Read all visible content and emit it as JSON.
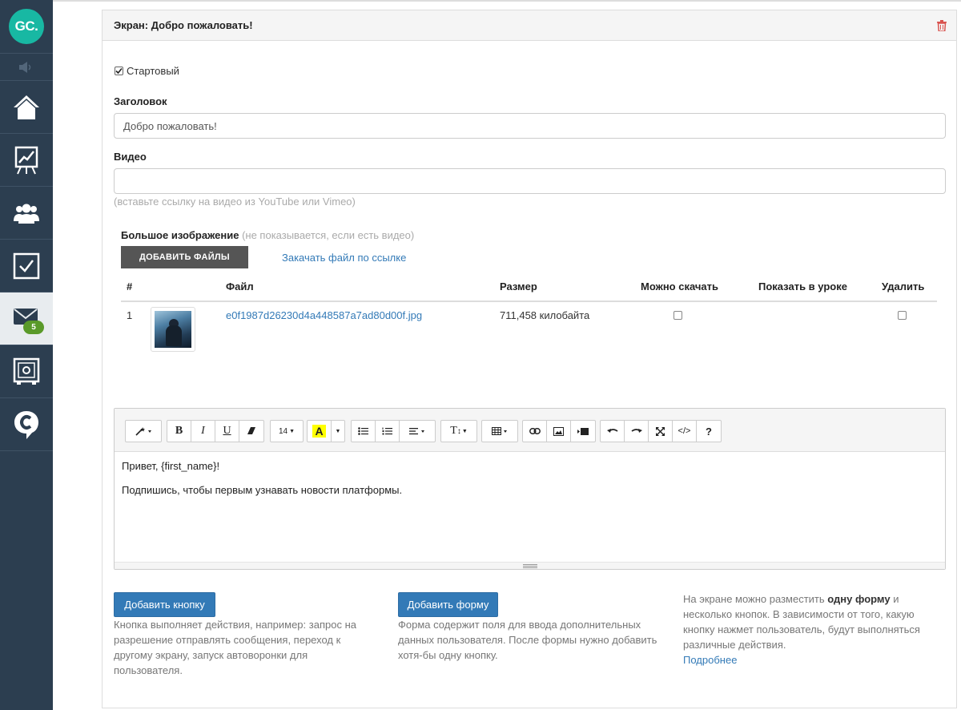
{
  "sidebar": {
    "logo_text": "GC.",
    "badge": "5",
    "items": [
      "home-icon",
      "chart-icon",
      "users-icon",
      "tasks-icon",
      "mail-icon",
      "safe-icon",
      "chat-icon"
    ]
  },
  "panel": {
    "title": "Экран: Добро пожаловать!"
  },
  "form": {
    "start_label": "Стартовый",
    "start_checked": true,
    "title_label": "Заголовок",
    "title_value": "Добро пожаловать!",
    "video_label": "Видео",
    "video_value": "",
    "video_hint": "(вставьте ссылку на видео из YouTube или Vimeo)",
    "image_label": "Большое изображение",
    "image_hint": "(не показывается, если есть видео)",
    "add_files_label": "ДОБАВИТЬ ФАЙЛЫ",
    "upload_link_label": "Закачать файл по ссылке"
  },
  "files": {
    "headers": [
      "#",
      "Файл",
      "Размер",
      "Можно скачать",
      "Показать в уроке",
      "Удалить"
    ],
    "rows": [
      {
        "num": "1",
        "name": "e0f1987d26230d4a448587a7ad80d00f.jpg",
        "size": "711,458 килобайта",
        "downloadable": false,
        "delete": false
      }
    ]
  },
  "editor": {
    "font_size": "14",
    "help": "?",
    "lines": [
      "Привет, {first_name}!",
      "Подпишись, чтобы первым узнавать новости платформы."
    ]
  },
  "actions": {
    "add_button_label": "Добавить кнопку",
    "add_button_desc": "Кнопка выполняет действия, например: запрос на разрешение отправлять сообщения, переход к другому экрану, запуск автоворонки для пользователя.",
    "add_form_label": "Добавить форму",
    "add_form_desc": "Форма содержит поля для ввода дополнительных данных пользователя. После формы нужно добавить хотя-бы одну кнопку.",
    "info_prefix": "На экране можно разместить ",
    "info_bold1": "одну форму",
    "info_middle": " и несколько кнопок. В зависимости от того, какую кнопку нажмет пользователь, будут выполняться различные действия.",
    "more_link": "Подробнее"
  },
  "colors": {
    "sidebar_bg": "#2c3e50",
    "logo": "#18b8a3",
    "primary": "#337ab7",
    "badge": "#5a9a2a",
    "delete_icon": "#d9534f"
  }
}
